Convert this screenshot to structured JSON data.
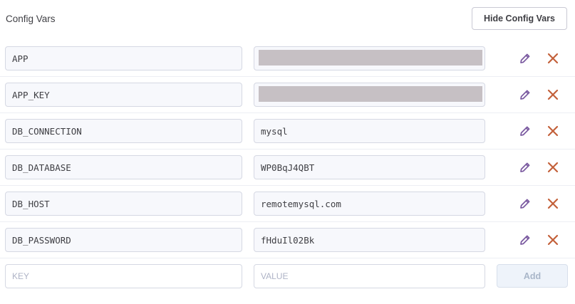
{
  "section": {
    "title": "Config Vars",
    "hide_button_label": "Hide Config Vars"
  },
  "vars": [
    {
      "key": "APP",
      "value": "",
      "redacted": true
    },
    {
      "key": "APP_KEY",
      "value": "",
      "redacted": true
    },
    {
      "key": "DB_CONNECTION",
      "value": "mysql",
      "redacted": false
    },
    {
      "key": "DB_DATABASE",
      "value": "WP0BqJ4QBT",
      "redacted": false
    },
    {
      "key": "DB_HOST",
      "value": "remotemysql.com",
      "redacted": false
    },
    {
      "key": "DB_PASSWORD",
      "value": "fHduIl02Bk",
      "redacted": false
    }
  ],
  "icons": {
    "edit": "pencil-icon",
    "delete": "close-icon"
  },
  "colors": {
    "edit_icon": "#79589f",
    "delete_icon": "#c3603a",
    "text": "#3f3f44"
  },
  "new_var": {
    "key_placeholder": "KEY",
    "value_placeholder": "VALUE",
    "add_label": "Add"
  }
}
